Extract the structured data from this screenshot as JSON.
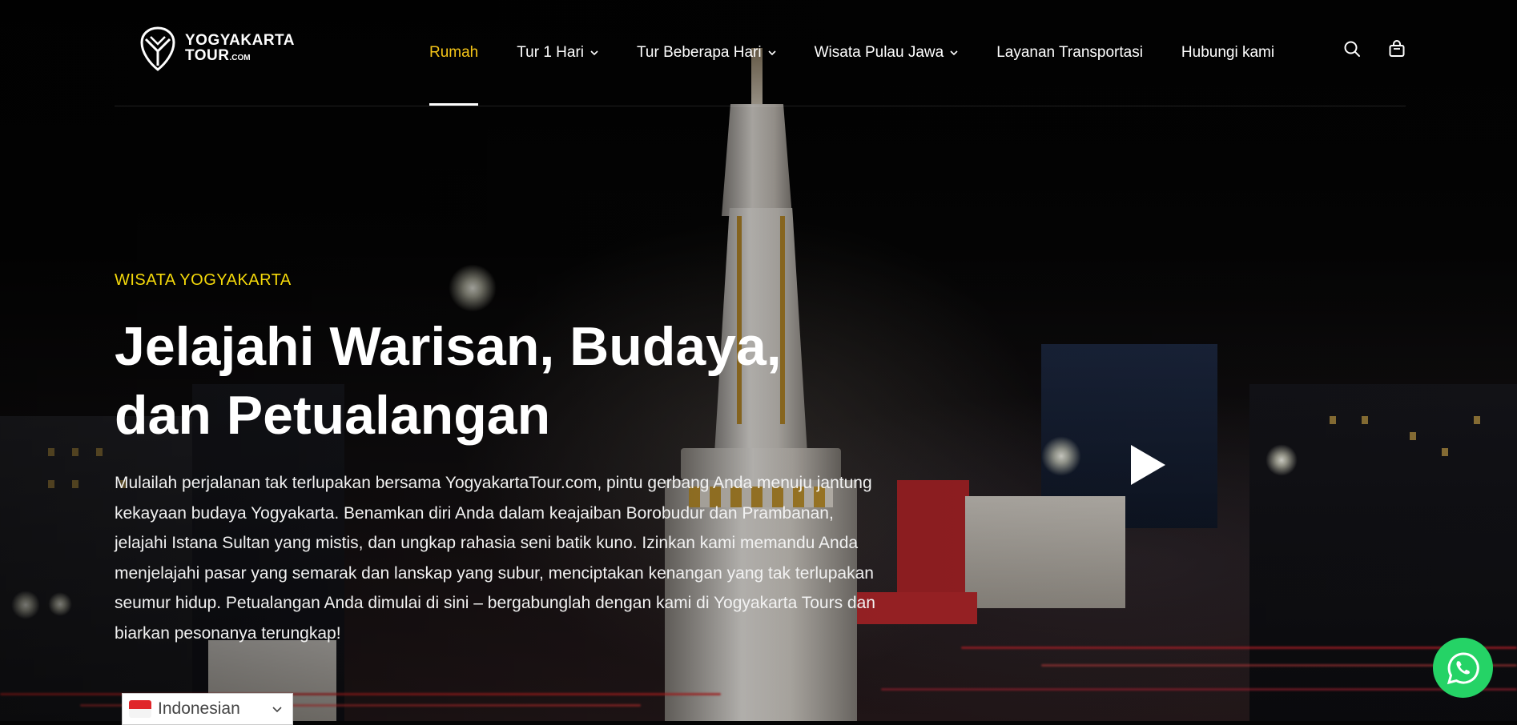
{
  "brand": {
    "name_line1": "YOGYAKARTA",
    "name_line2": "TOUR",
    "name_suffix": ".COM"
  },
  "nav": {
    "items": [
      {
        "label": "Rumah",
        "active": true,
        "dropdown": false
      },
      {
        "label": "Tur 1 Hari",
        "active": false,
        "dropdown": true
      },
      {
        "label": "Tur Beberapa Hari",
        "active": false,
        "dropdown": true
      },
      {
        "label": "Wisata Pulau Jawa",
        "active": false,
        "dropdown": true
      },
      {
        "label": "Layanan Transportasi",
        "active": false,
        "dropdown": false
      },
      {
        "label": "Hubungi kami",
        "active": false,
        "dropdown": false
      }
    ]
  },
  "header_icons": [
    "search-icon",
    "shopping-bag-icon"
  ],
  "hero": {
    "eyebrow": "WISATA YOGYAKARTA",
    "headline_line1": "Jelajahi Warisan, Budaya,",
    "headline_line2": "dan Petualangan",
    "description": "Mulailah perjalanan tak terlupakan bersama YogyakartaTour.com, pintu gerbang Anda menuju jantung kekayaan budaya Yogyakarta. Benamkan diri Anda dalam keajaiban Borobudur dan Prambanan, jelajahi Istana Sultan yang mistis, dan ungkap rahasia seni batik kuno. Izinkan kami memandu Anda menjelajahi pasar yang semarak dan lanskap yang subur, menciptakan kenangan yang tak terlupakan seumur hidup. Petualangan Anda dimulai di sini – bergabunglah dengan kami di Yogyakarta Tours dan biarkan pesonanya terungkap!"
  },
  "language_selector": {
    "selected": "Indonesian"
  },
  "colors": {
    "accent": "#f5c518",
    "eyebrow": "#f5d90a",
    "whatsapp": "#25d366"
  }
}
